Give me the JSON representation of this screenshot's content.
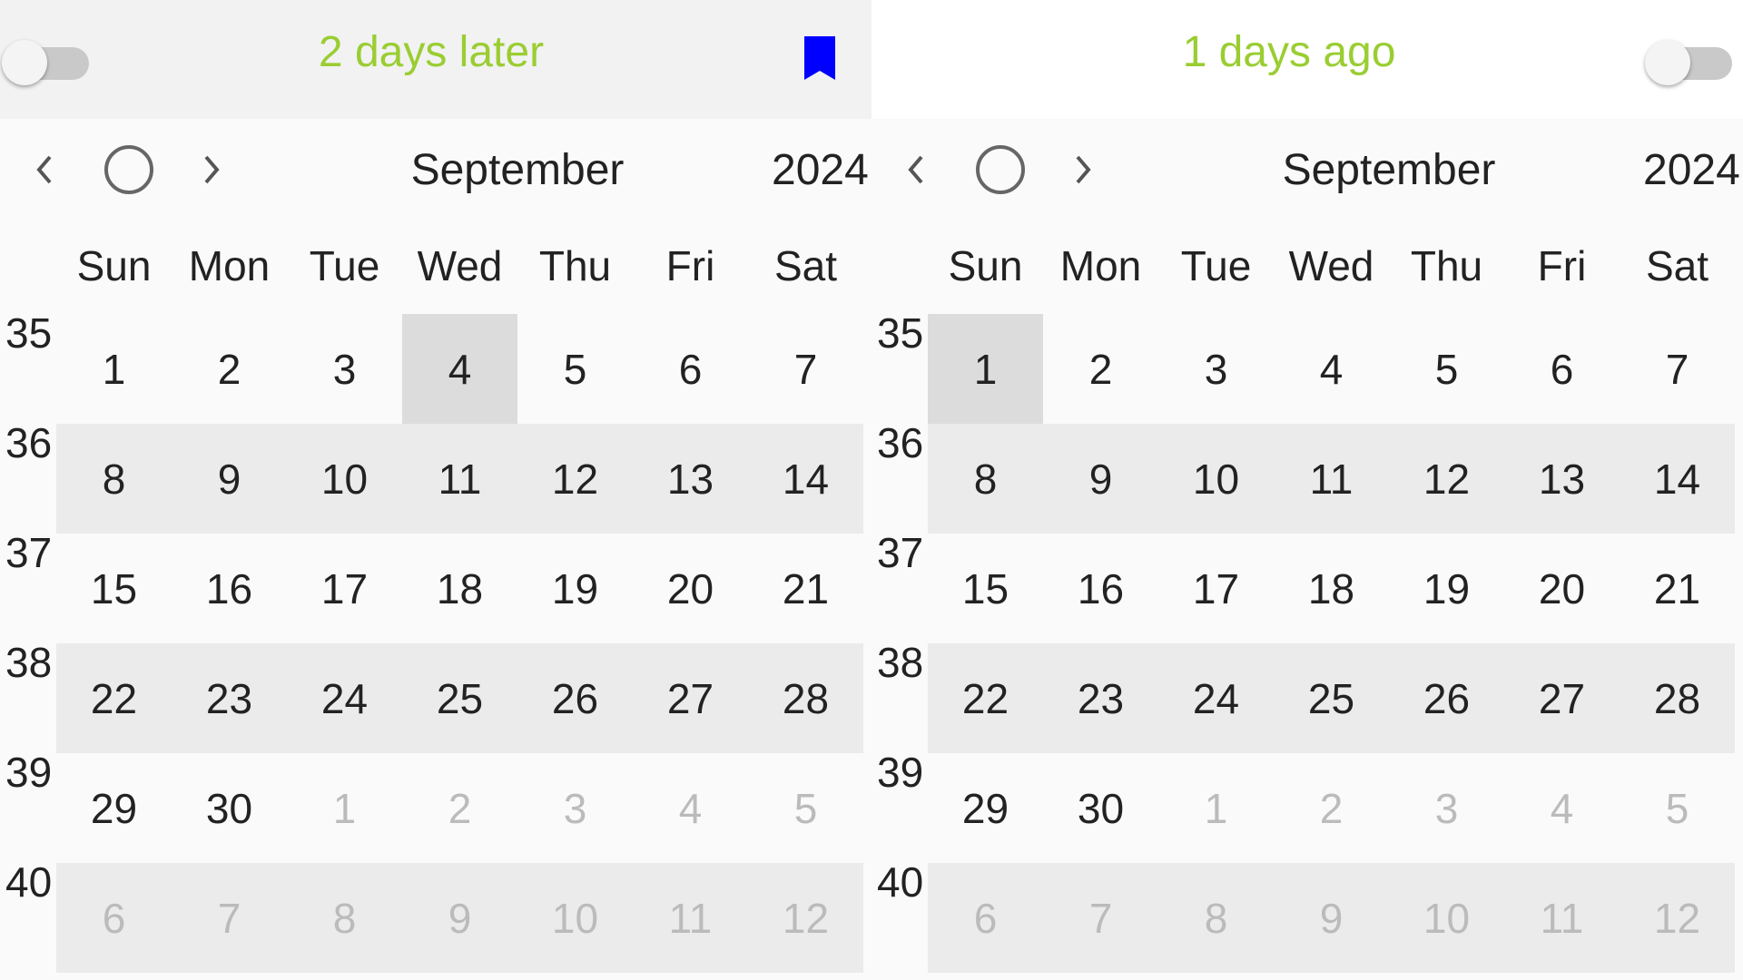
{
  "colors": {
    "accent_green": "#9ACD32",
    "bookmark_left": "#0000FF",
    "bookmark_right": "#FF0000"
  },
  "panels": [
    {
      "relative_label": "2 days later",
      "toggle_on": false,
      "bookmark_color": "blue",
      "month": "September",
      "year": "2024",
      "weekdays": [
        "Sun",
        "Mon",
        "Tue",
        "Wed",
        "Thu",
        "Fri",
        "Sat"
      ],
      "weeks": [
        {
          "number": "35",
          "days": [
            {
              "d": "1",
              "other": false
            },
            {
              "d": "2",
              "other": false
            },
            {
              "d": "3",
              "other": false
            },
            {
              "d": "4",
              "other": false,
              "selected": true
            },
            {
              "d": "5",
              "other": false
            },
            {
              "d": "6",
              "other": false
            },
            {
              "d": "7",
              "other": false
            }
          ]
        },
        {
          "number": "36",
          "days": [
            {
              "d": "8",
              "other": false
            },
            {
              "d": "9",
              "other": false
            },
            {
              "d": "10",
              "other": false
            },
            {
              "d": "11",
              "other": false
            },
            {
              "d": "12",
              "other": false
            },
            {
              "d": "13",
              "other": false
            },
            {
              "d": "14",
              "other": false
            }
          ]
        },
        {
          "number": "37",
          "days": [
            {
              "d": "15",
              "other": false
            },
            {
              "d": "16",
              "other": false
            },
            {
              "d": "17",
              "other": false
            },
            {
              "d": "18",
              "other": false
            },
            {
              "d": "19",
              "other": false
            },
            {
              "d": "20",
              "other": false
            },
            {
              "d": "21",
              "other": false
            }
          ]
        },
        {
          "number": "38",
          "days": [
            {
              "d": "22",
              "other": false
            },
            {
              "d": "23",
              "other": false
            },
            {
              "d": "24",
              "other": false
            },
            {
              "d": "25",
              "other": false
            },
            {
              "d": "26",
              "other": false
            },
            {
              "d": "27",
              "other": false
            },
            {
              "d": "28",
              "other": false
            }
          ]
        },
        {
          "number": "39",
          "days": [
            {
              "d": "29",
              "other": false
            },
            {
              "d": "30",
              "other": false
            },
            {
              "d": "1",
              "other": true
            },
            {
              "d": "2",
              "other": true
            },
            {
              "d": "3",
              "other": true
            },
            {
              "d": "4",
              "other": true
            },
            {
              "d": "5",
              "other": true
            }
          ]
        },
        {
          "number": "40",
          "days": [
            {
              "d": "6",
              "other": true
            },
            {
              "d": "7",
              "other": true
            },
            {
              "d": "8",
              "other": true
            },
            {
              "d": "9",
              "other": true
            },
            {
              "d": "10",
              "other": true
            },
            {
              "d": "11",
              "other": true
            },
            {
              "d": "12",
              "other": true
            }
          ]
        }
      ]
    },
    {
      "relative_label": "1 days ago",
      "toggle_on": false,
      "bookmark_color": "red",
      "month": "September",
      "year": "2024",
      "weekdays": [
        "Sun",
        "Mon",
        "Tue",
        "Wed",
        "Thu",
        "Fri",
        "Sat"
      ],
      "weeks": [
        {
          "number": "35",
          "days": [
            {
              "d": "1",
              "other": false,
              "selected": true
            },
            {
              "d": "2",
              "other": false
            },
            {
              "d": "3",
              "other": false
            },
            {
              "d": "4",
              "other": false
            },
            {
              "d": "5",
              "other": false
            },
            {
              "d": "6",
              "other": false
            },
            {
              "d": "7",
              "other": false
            }
          ]
        },
        {
          "number": "36",
          "days": [
            {
              "d": "8",
              "other": false
            },
            {
              "d": "9",
              "other": false
            },
            {
              "d": "10",
              "other": false
            },
            {
              "d": "11",
              "other": false
            },
            {
              "d": "12",
              "other": false
            },
            {
              "d": "13",
              "other": false
            },
            {
              "d": "14",
              "other": false
            }
          ]
        },
        {
          "number": "37",
          "days": [
            {
              "d": "15",
              "other": false
            },
            {
              "d": "16",
              "other": false
            },
            {
              "d": "17",
              "other": false
            },
            {
              "d": "18",
              "other": false
            },
            {
              "d": "19",
              "other": false
            },
            {
              "d": "20",
              "other": false
            },
            {
              "d": "21",
              "other": false
            }
          ]
        },
        {
          "number": "38",
          "days": [
            {
              "d": "22",
              "other": false
            },
            {
              "d": "23",
              "other": false
            },
            {
              "d": "24",
              "other": false
            },
            {
              "d": "25",
              "other": false
            },
            {
              "d": "26",
              "other": false
            },
            {
              "d": "27",
              "other": false
            },
            {
              "d": "28",
              "other": false
            }
          ]
        },
        {
          "number": "39",
          "days": [
            {
              "d": "29",
              "other": false
            },
            {
              "d": "30",
              "other": false
            },
            {
              "d": "1",
              "other": true
            },
            {
              "d": "2",
              "other": true
            },
            {
              "d": "3",
              "other": true
            },
            {
              "d": "4",
              "other": true
            },
            {
              "d": "5",
              "other": true
            }
          ]
        },
        {
          "number": "40",
          "days": [
            {
              "d": "6",
              "other": true
            },
            {
              "d": "7",
              "other": true
            },
            {
              "d": "8",
              "other": true
            },
            {
              "d": "9",
              "other": true
            },
            {
              "d": "10",
              "other": true
            },
            {
              "d": "11",
              "other": true
            },
            {
              "d": "12",
              "other": true
            }
          ]
        }
      ]
    }
  ]
}
